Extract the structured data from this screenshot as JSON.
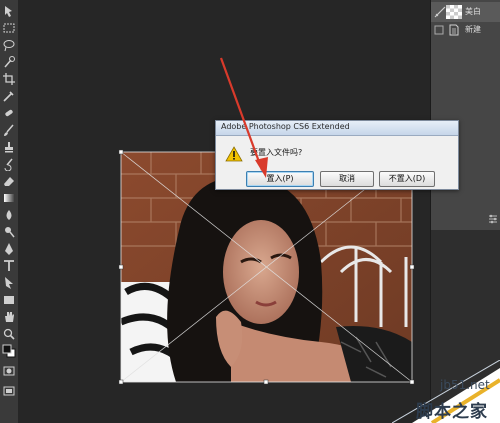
{
  "layers": [
    {
      "name": "美白",
      "icon": "layer-thumbnail-icon"
    },
    {
      "name": "新建",
      "icon": "document-icon"
    }
  ],
  "dialog": {
    "title": "Adobe Photoshop CS6 Extended",
    "message": "要置入文件吗?",
    "icon": "warning-icon",
    "buttons": {
      "place": "置入(P)",
      "cancel": "取消",
      "dont_place": "不置入(D)"
    }
  },
  "watermark": {
    "url": "jb51.net",
    "name": "脚本之家"
  },
  "colors": {
    "warning": "#f2c200",
    "arrow": "#d93a2b",
    "default_button_border": "#3c7fb1"
  }
}
